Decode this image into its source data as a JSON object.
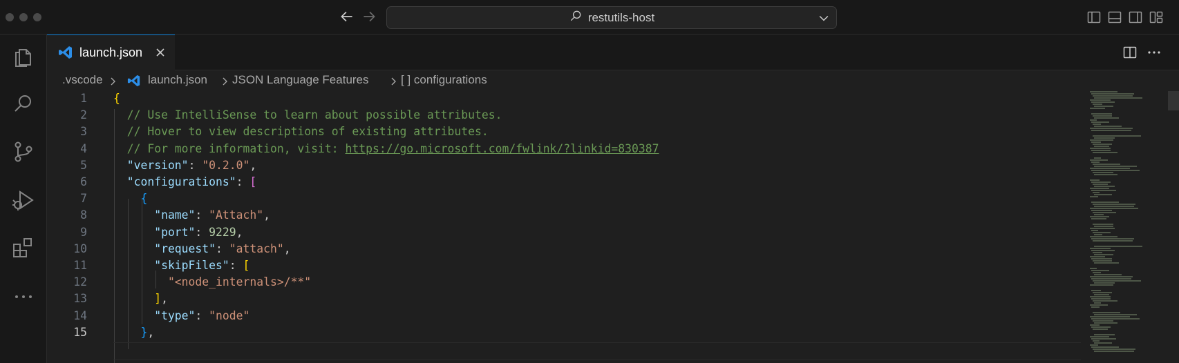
{
  "window": {
    "search_text": "restutils-host"
  },
  "tab": {
    "label": "launch.json"
  },
  "breadcrumbs": [
    ".vscode",
    "launch.json",
    "JSON Language Features",
    "[ ] configurations"
  ],
  "editor": {
    "active_line": 15,
    "lines": [
      {
        "n": "1",
        "tokens": [
          {
            "t": "{",
            "c": "brace1"
          }
        ]
      },
      {
        "n": "2",
        "tokens": [
          {
            "t": "  // Use IntelliSense to learn about possible attributes.",
            "c": "cmt"
          }
        ]
      },
      {
        "n": "3",
        "tokens": [
          {
            "t": "  // Hover to view descriptions of existing attributes.",
            "c": "cmt"
          }
        ]
      },
      {
        "n": "4",
        "tokens": [
          {
            "t": "  // For more information, visit: ",
            "c": "cmt"
          },
          {
            "t": "https://go.microsoft.com/fwlink/?linkid=830387",
            "c": "link"
          }
        ]
      },
      {
        "n": "5",
        "tokens": [
          {
            "t": "  \"version\"",
            "c": "key"
          },
          {
            "t": ": ",
            "c": "punc"
          },
          {
            "t": "\"0.2.0\"",
            "c": "str"
          },
          {
            "t": ",",
            "c": "punc"
          }
        ]
      },
      {
        "n": "6",
        "tokens": [
          {
            "t": "  \"configurations\"",
            "c": "key"
          },
          {
            "t": ": ",
            "c": "punc"
          },
          {
            "t": "[",
            "c": "brace2"
          }
        ]
      },
      {
        "n": "7",
        "tokens": [
          {
            "t": "    {",
            "c": "brace3"
          }
        ]
      },
      {
        "n": "8",
        "tokens": [
          {
            "t": "      \"name\"",
            "c": "key"
          },
          {
            "t": ": ",
            "c": "punc"
          },
          {
            "t": "\"Attach\"",
            "c": "str"
          },
          {
            "t": ",",
            "c": "punc"
          }
        ]
      },
      {
        "n": "9",
        "tokens": [
          {
            "t": "      \"port\"",
            "c": "key"
          },
          {
            "t": ": ",
            "c": "punc"
          },
          {
            "t": "9229",
            "c": "num"
          },
          {
            "t": ",",
            "c": "punc"
          }
        ]
      },
      {
        "n": "10",
        "tokens": [
          {
            "t": "      \"request\"",
            "c": "key"
          },
          {
            "t": ": ",
            "c": "punc"
          },
          {
            "t": "\"attach\"",
            "c": "str"
          },
          {
            "t": ",",
            "c": "punc"
          }
        ]
      },
      {
        "n": "11",
        "tokens": [
          {
            "t": "      \"skipFiles\"",
            "c": "key"
          },
          {
            "t": ": ",
            "c": "punc"
          },
          {
            "t": "[",
            "c": "brace1"
          }
        ]
      },
      {
        "n": "12",
        "tokens": [
          {
            "t": "        \"<node_internals>/**\"",
            "c": "str"
          }
        ]
      },
      {
        "n": "13",
        "tokens": [
          {
            "t": "      ]",
            "c": "brace1"
          },
          {
            "t": ",",
            "c": "punc"
          }
        ]
      },
      {
        "n": "14",
        "tokens": [
          {
            "t": "      \"type\"",
            "c": "key"
          },
          {
            "t": ": ",
            "c": "punc"
          },
          {
            "t": "\"node\"",
            "c": "str"
          }
        ]
      },
      {
        "n": "15",
        "tokens": [
          {
            "t": "    }",
            "c": "brace3"
          },
          {
            "t": ",",
            "c": "punc"
          }
        ]
      }
    ]
  },
  "colors": {
    "accent": "#0078d4",
    "background": "#1f1f1f",
    "comment": "#6a9955",
    "string": "#ce9178",
    "key": "#9cdcfe"
  },
  "icons": {
    "activity_bar": [
      "explorer-icon",
      "search-icon",
      "source-control-icon",
      "run-debug-icon",
      "extensions-icon",
      "more-icon"
    ],
    "title_bar": [
      "back-arrow-icon",
      "forward-arrow-icon",
      "search-icon",
      "chevron-down-icon",
      "toggle-primary-sidebar-icon",
      "toggle-panel-icon",
      "toggle-secondary-sidebar-icon",
      "customize-layout-icon"
    ],
    "editor": [
      "split-editor-icon",
      "more-actions-icon",
      "vscode-json-icon",
      "close-icon"
    ]
  }
}
